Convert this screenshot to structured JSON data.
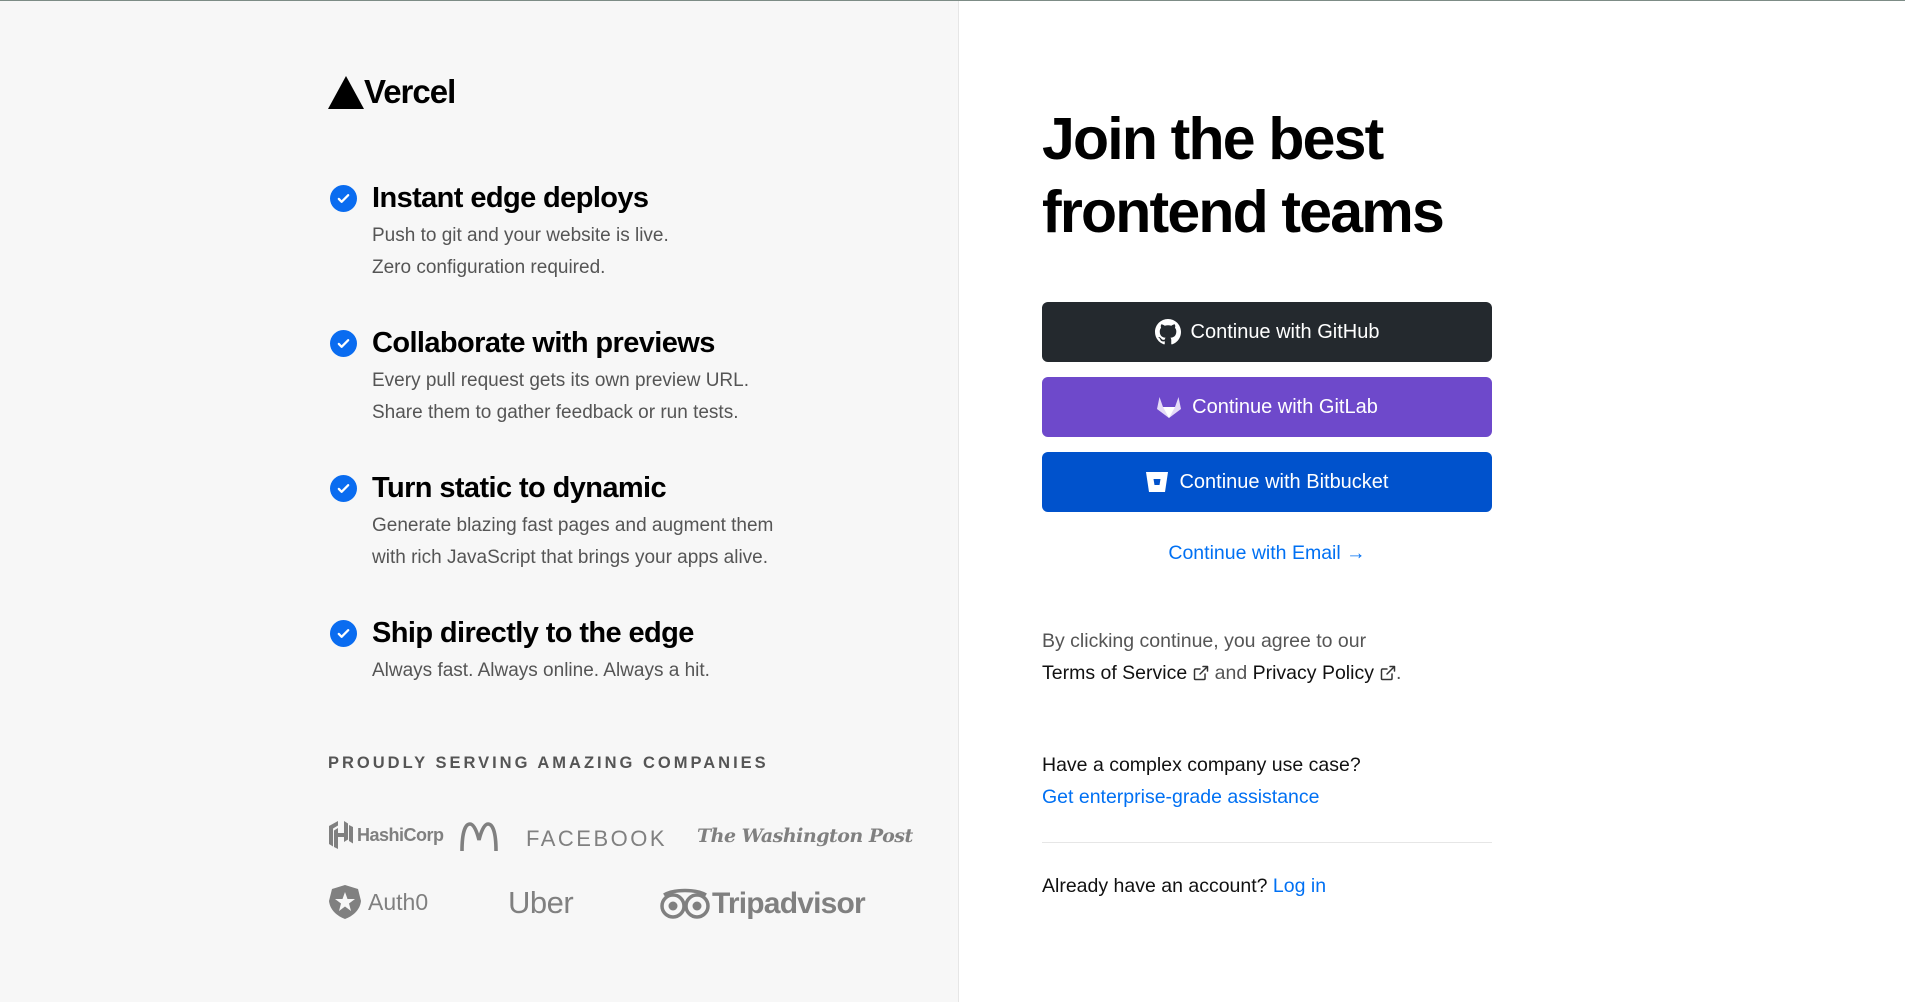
{
  "brand": {
    "name": "Vercel"
  },
  "features": [
    {
      "title": "Instant edge deploys",
      "lines": [
        "Push to git and your website is live.",
        "Zero configuration required."
      ]
    },
    {
      "title": "Collaborate with previews",
      "lines": [
        "Every pull request gets its own preview URL.",
        "Share them to gather feedback or run tests."
      ]
    },
    {
      "title": "Turn static to dynamic",
      "lines": [
        "Generate blazing fast pages and augment them",
        "with rich JavaScript that brings your apps alive."
      ]
    },
    {
      "title": "Ship directly to the edge",
      "lines": [
        "Always fast. Always online. Always a hit."
      ]
    }
  ],
  "companies": {
    "heading": "PROUDLY SERVING AMAZING COMPANIES",
    "logos": [
      "HashiCorp",
      "McDonald's",
      "FACEBOOK",
      "The Washington Post",
      "Auth0",
      "Uber",
      "Tripadvisor"
    ]
  },
  "signup": {
    "headline_line1": "Join the best",
    "headline_line2": "frontend teams",
    "github_label": "Continue with GitHub",
    "gitlab_label": "Continue with GitLab",
    "bitbucket_label": "Continue with Bitbucket",
    "email_label": "Continue with Email →",
    "terms_prefix": "By clicking continue, you agree to our",
    "terms_of_service": "Terms of Service",
    "terms_and": "and",
    "privacy_policy": "Privacy Policy",
    "terms_suffix": ".",
    "enterprise_question": "Have a complex company use case?",
    "enterprise_link": "Get enterprise-grade assistance",
    "login_prompt": "Already have an account?",
    "login_link": "Log in"
  },
  "colors": {
    "accent": "#0070f3",
    "github": "#24292e",
    "gitlab": "#6e49cb",
    "bitbucket": "#0052cc",
    "check": "#0a6cf0"
  }
}
